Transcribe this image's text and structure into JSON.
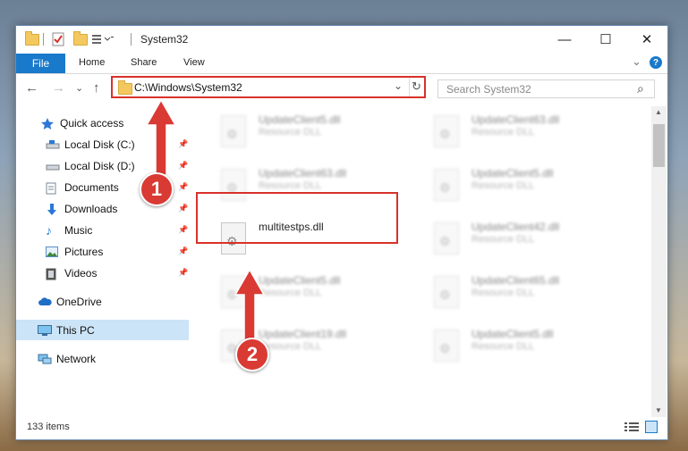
{
  "window": {
    "title": "System32",
    "minimize_glyph": "—",
    "maximize_glyph": "☐",
    "close_glyph": "✕"
  },
  "ribbon": {
    "tabs": [
      "File",
      "Home",
      "Share",
      "View"
    ],
    "expand_glyph": "⌄",
    "help_glyph": "?"
  },
  "nav": {
    "back_glyph": "←",
    "forward_glyph": "→",
    "recent_glyph": "⌄",
    "up_glyph": "↑",
    "address": "C:\\Windows\\System32",
    "refresh_glyph": "↻",
    "search_placeholder": "Search System32",
    "search_glyph": "⌕"
  },
  "sidebar": {
    "items": [
      {
        "label": "Quick access",
        "icon": "star-icon"
      },
      {
        "label": "Local Disk (C:)",
        "icon": "drive-icon",
        "pinned": true
      },
      {
        "label": "Local Disk (D:)",
        "icon": "drive-icon",
        "pinned": true
      },
      {
        "label": "Documents",
        "icon": "document-icon",
        "pinned": true
      },
      {
        "label": "Downloads",
        "icon": "download-icon",
        "pinned": true
      },
      {
        "label": "Music",
        "icon": "music-icon",
        "pinned": true
      },
      {
        "label": "Pictures",
        "icon": "pictures-icon",
        "pinned": true
      },
      {
        "label": "Videos",
        "icon": "videos-icon",
        "pinned": true
      },
      {
        "label": "OneDrive",
        "icon": "cloud-icon"
      },
      {
        "label": "This PC",
        "icon": "computer-icon",
        "selected": true
      },
      {
        "label": "Network",
        "icon": "network-icon"
      }
    ]
  },
  "files": [
    {
      "name": "UpdateClient5.dll",
      "type": "Resource DLL"
    },
    {
      "name": "UpdateClient63.dll",
      "type": "Resource DLL"
    },
    {
      "name": "UpdateClient63.dll",
      "type": "Resource DLL"
    },
    {
      "name": "UpdateClient5.dll",
      "type": "Resource DLL"
    },
    {
      "name": "multitestps.dll",
      "type": ""
    },
    {
      "name": "UpdateClient42.dll",
      "type": "Resource DLL"
    },
    {
      "name": "UpdateClient5.dll",
      "type": "Resource DLL"
    },
    {
      "name": "UpdateClient65.dll",
      "type": "Resource DLL"
    },
    {
      "name": "UpdateClient19.dll",
      "type": "Resource DLL"
    },
    {
      "name": "UpdateClient5.dll",
      "type": "Resource DLL"
    }
  ],
  "status": {
    "item_count": "133 items"
  },
  "annotations": {
    "step1": "1",
    "step2": "2"
  },
  "colors": {
    "accent": "#1979ca",
    "highlight_red": "#d9312a",
    "badge_red": "#d93a33",
    "selected_bg": "#cce4f7"
  }
}
